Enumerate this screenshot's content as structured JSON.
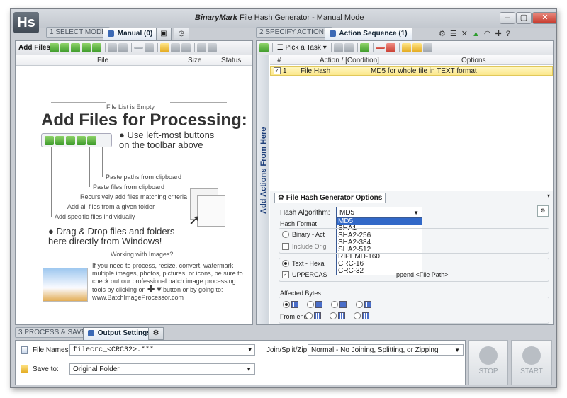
{
  "app": {
    "logo": "Hs",
    "brand": "BinaryMark",
    "title": "File Hash Generator - Manual Mode"
  },
  "window_controls": {
    "minimize": "–",
    "maximize": "▢",
    "close": "✕"
  },
  "steps": {
    "select_mode": "1  SELECT MODE",
    "specify_actions": "2  SPECIFY ACTIONS",
    "process_save": "3  PROCESS & SAVE"
  },
  "tabs": {
    "manual": "Manual (0)",
    "action_sequence": "Action Sequence (1)",
    "output_settings": "Output Settings"
  },
  "left": {
    "add_files_label": "Add Files:",
    "columns": [
      "File",
      "Size",
      "Status"
    ],
    "empty_note": "File List is Empty",
    "headline": "Add Files for Processing:",
    "tip1": "Use left-most buttons on the toolbar above",
    "callouts": [
      "Paste paths from clipboard",
      "Paste files from clipboard",
      "Recursively add files matching criteria",
      "Add all files from a given folder",
      "Add specific files individually"
    ],
    "tip2": "Drag & Drop files and folders here directly from Windows!",
    "images_note": "Working with Images?",
    "images_text": "If you need to process, resize, convert, watermark multiple images, photos, pictures, or icons, be sure to check out our professional batch image processing tools by clicking on",
    "images_text2": "button or by going to: www.BatchImageProcessor.com"
  },
  "right": {
    "pick_task": "Pick a Task",
    "columns": [
      "#",
      "Action / [Condition]",
      "Options"
    ],
    "rows": [
      {
        "num": "1",
        "action": "File Hash",
        "options": "MD5 for whole file in TEXT format"
      }
    ],
    "side_label": "Add Actions From Here",
    "options_tab": "File Hash Generator Options",
    "hash_algorithm_label": "Hash Algorithm:",
    "hash_algorithm_value": "MD5",
    "algorithms": [
      "MD5",
      "SHA1",
      "SHA2-256",
      "SHA2-384",
      "SHA2-512",
      "RIPEMD-160",
      "CRC-16",
      "CRC-32"
    ],
    "hash_format_label": "Hash Format",
    "binary_label": "Binary - Act",
    "include_label": "Include Orig",
    "text_label": "Text - Hexa",
    "uppercase_label": "UPPERCAS",
    "append_label": "ppend <File Path>",
    "affected_bytes_label": "Affected Bytes",
    "from_end_label": "From end:"
  },
  "bottom": {
    "file_names_label": "File Names:",
    "file_names_value": "filecrc_<CRC32>.***",
    "save_to_label": "Save to:",
    "save_to_value": "Original Folder",
    "join_label": "Join/Split/Zip:",
    "join_value": "Normal - No Joining, Splitting, or Zipping",
    "stop": "STOP",
    "start": "START"
  }
}
